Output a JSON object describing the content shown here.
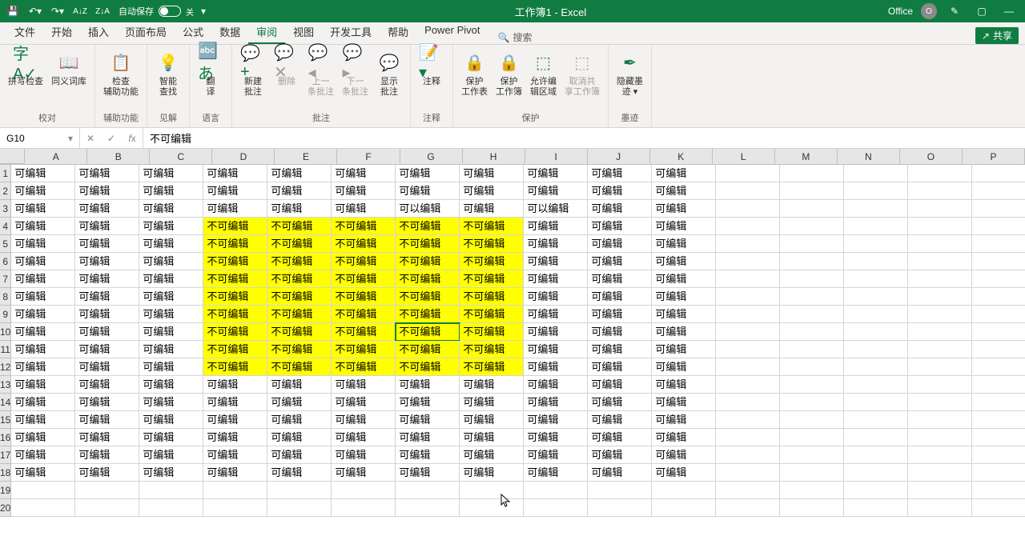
{
  "titlebar": {
    "autosave_label": "自动保存",
    "autosave_off": "关",
    "title": "工作簿1 - Excel",
    "office_label": "Office",
    "user_initial": "O"
  },
  "tabs": {
    "items": [
      "文件",
      "开始",
      "插入",
      "页面布局",
      "公式",
      "数据",
      "审阅",
      "视图",
      "开发工具",
      "帮助",
      "Power Pivot"
    ],
    "active_index": 6,
    "search_label": "搜索",
    "share_label": "共享"
  },
  "ribbon": {
    "groups": [
      {
        "label": "校对",
        "buttons": [
          {
            "label": "拼写检查",
            "icon": "字A✓"
          },
          {
            "label": "同义词库",
            "icon": "📖"
          }
        ]
      },
      {
        "label": "辅助功能",
        "buttons": [
          {
            "label": "检查\n辅助功能",
            "icon": "📋"
          }
        ]
      },
      {
        "label": "见解",
        "buttons": [
          {
            "label": "智能\n查找",
            "icon": "💡"
          }
        ]
      },
      {
        "label": "语言",
        "buttons": [
          {
            "label": "翻\n译",
            "icon": "🔤あ"
          }
        ]
      },
      {
        "label": "批注",
        "buttons": [
          {
            "label": "新建\n批注",
            "icon": "💬+"
          },
          {
            "label": "删除",
            "icon": "💬✕",
            "disabled": true
          },
          {
            "label": "上一\n条批注",
            "icon": "💬◂",
            "disabled": true
          },
          {
            "label": "下一\n条批注",
            "icon": "💬▸",
            "disabled": true
          },
          {
            "label": "显示\n批注",
            "icon": "💬"
          }
        ]
      },
      {
        "label": "注释",
        "buttons": [
          {
            "label": "注释",
            "icon": "📝▾"
          }
        ]
      },
      {
        "label": "保护",
        "buttons": [
          {
            "label": "保护\n工作表",
            "icon": "🔒"
          },
          {
            "label": "保护\n工作簿",
            "icon": "🔒"
          },
          {
            "label": "允许编\n辑区域",
            "icon": "⬚"
          },
          {
            "label": "取消共\n享工作簿",
            "icon": "⬚",
            "disabled": true
          }
        ]
      },
      {
        "label": "墨迹",
        "buttons": [
          {
            "label": "隐藏墨\n迹 ▾",
            "icon": "✒"
          }
        ]
      }
    ]
  },
  "formula_bar": {
    "name_box": "G10",
    "formula": "不可编辑"
  },
  "grid": {
    "columns": [
      "A",
      "B",
      "C",
      "D",
      "E",
      "F",
      "G",
      "H",
      "I",
      "J",
      "K",
      "L",
      "M",
      "N",
      "O",
      "P"
    ],
    "rows": 20,
    "selected": {
      "row": 10,
      "col": 6
    },
    "yellow_range": {
      "rowStart": 4,
      "rowEnd": 12,
      "colStart": 3,
      "colEnd": 7
    },
    "text_editable": "可编辑",
    "text_noteditable": "不可编辑",
    "text_caneditable": "可以编辑",
    "data_rowspan": 18,
    "filled_cols": 11,
    "special_cells": [
      {
        "row": 3,
        "col": 6,
        "text": "可以编辑"
      },
      {
        "row": 3,
        "col": 8,
        "text": "可以编辑"
      }
    ]
  }
}
